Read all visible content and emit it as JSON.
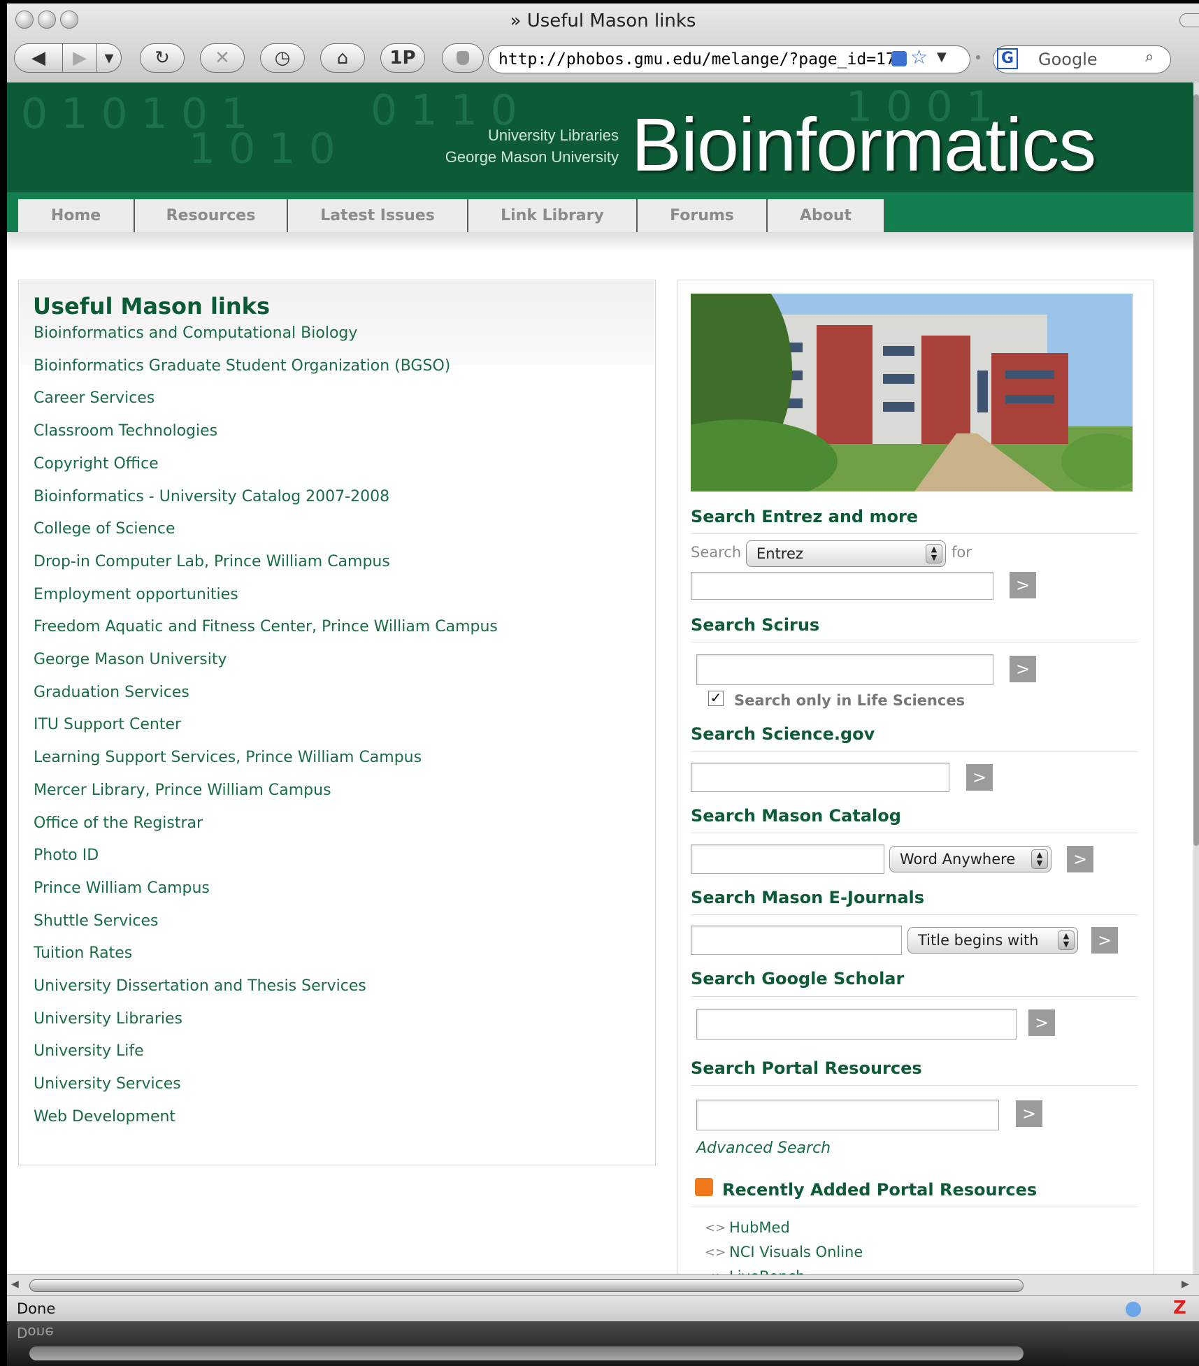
{
  "window": {
    "title": "» Useful Mason links",
    "url": "http://phobos.gmu.edu/melange/?page_id=17",
    "search_placeholder": "Google",
    "status": "Done"
  },
  "toolbar": {
    "back_icon": "◀",
    "forward_icon": "▶",
    "menu_icon": "▾",
    "reload_icon": "↻",
    "stop_icon": "✕",
    "history_icon": "◷",
    "home_icon": "⌂",
    "onepassword_label": "1P"
  },
  "banner": {
    "line1": "University Libraries",
    "line2": "George Mason University",
    "title": "Bioinformatics"
  },
  "nav": [
    "Home",
    "Resources",
    "Latest Issues",
    "Link Library",
    "Forums",
    "About"
  ],
  "main": {
    "title": "Useful Mason links",
    "links": [
      "Bioinformatics and Computational Biology",
      "Bioinformatics Graduate Student Organization (BGSO)",
      "Career Services",
      "Classroom Technologies",
      "Copyright Office",
      "Bioinformatics - University Catalog 2007-2008",
      "College of Science",
      "Drop-in Computer Lab, Prince William Campus",
      "Employment opportunities",
      "Freedom Aquatic and Fitness Center, Prince William Campus",
      "George Mason University",
      "Graduation Services",
      "ITU Support Center",
      "Learning Support Services, Prince William Campus",
      "Mercer Library, Prince William Campus",
      "Office of the Registrar",
      "Photo ID",
      "Prince William Campus",
      "Shuttle Services",
      "Tuition Rates",
      "University Dissertation and Thesis Services",
      "University Libraries",
      "University Life",
      "University Services",
      "Web Development"
    ]
  },
  "sidebar": {
    "entrez": {
      "heading": "Search Entrez and more",
      "search_label": "Search",
      "select_value": "Entrez",
      "for_label": "for",
      "go": ">"
    },
    "scirus": {
      "heading": "Search Scirus",
      "checkbox_label": "Search only in Life Sciences",
      "checked": true,
      "go": ">"
    },
    "sciencegov": {
      "heading": "Search Science.gov",
      "go": ">"
    },
    "catalog": {
      "heading": "Search Mason Catalog",
      "select_value": "Word Anywhere",
      "go": ">"
    },
    "ejournals": {
      "heading": "Search Mason E-Journals",
      "select_value": "Title begins with",
      "go": ">"
    },
    "scholar": {
      "heading": "Search Google Scholar",
      "go": ">"
    },
    "portal": {
      "heading": "Search Portal Resources",
      "advanced": "Advanced Search",
      "go": ">"
    },
    "recent": {
      "heading": "Recently Added Portal Resources",
      "bullet": "<>",
      "items": [
        "HubMed",
        "NCI Visuals Online",
        "LiveBench"
      ]
    }
  },
  "colors": {
    "brand_green": "#0c5a36",
    "nav_green": "#137f4f",
    "link_green": "#1a6c45"
  }
}
